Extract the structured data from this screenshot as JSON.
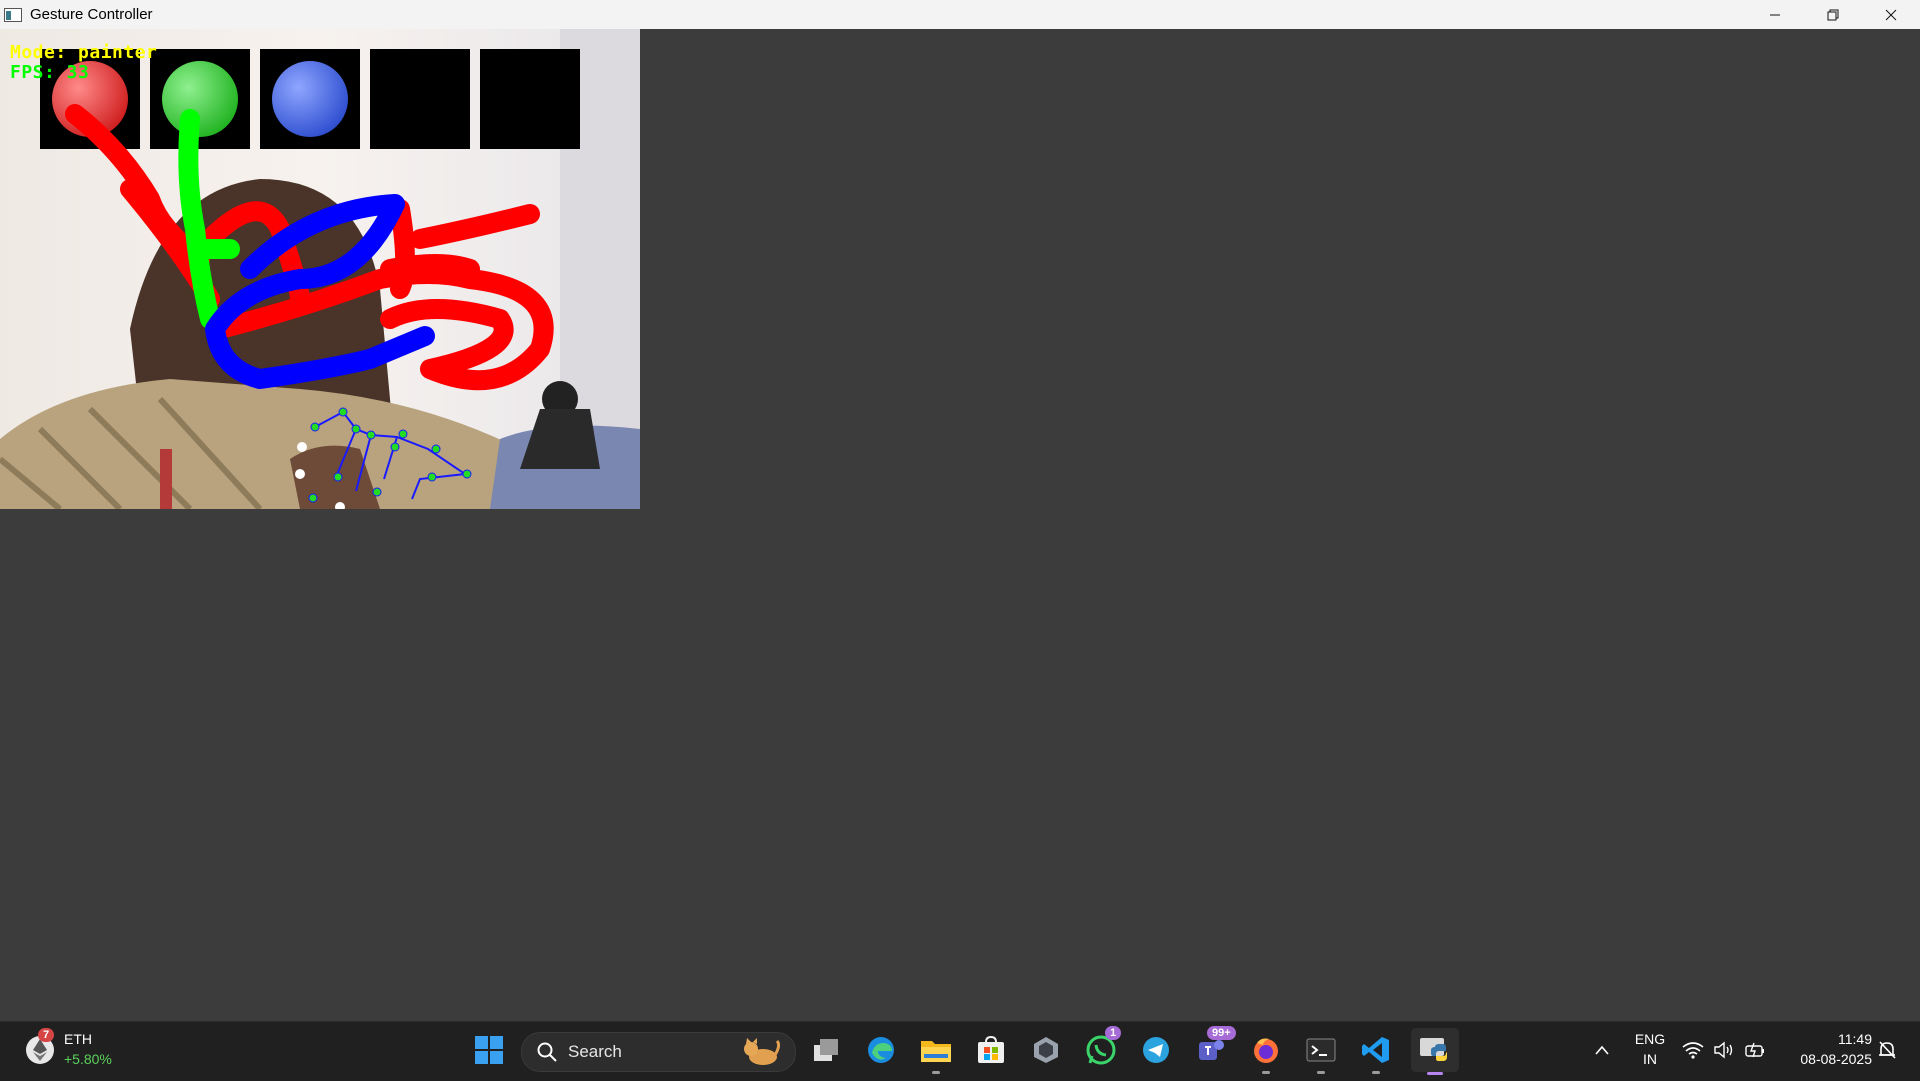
{
  "window": {
    "title": "Gesture Controller",
    "buttons": [
      "minimize",
      "restore",
      "close"
    ]
  },
  "camera_overlay": {
    "mode_text": "Mode: painter",
    "fps_text": "FPS: 33",
    "palette": [
      {
        "name": "red",
        "color": "#e53935"
      },
      {
        "name": "green",
        "color": "#33d133"
      },
      {
        "name": "blue",
        "color": "#3a5bd9"
      },
      {
        "name": "empty-1",
        "color": "#000000"
      },
      {
        "name": "empty-2",
        "color": "#000000"
      }
    ],
    "stroke_colors": {
      "red": "#ff0000",
      "green": "#00ff00",
      "blue": "#0000ff"
    }
  },
  "taskbar": {
    "widget": {
      "ticker": "ETH",
      "change": "+5.80%",
      "badge": "7",
      "change_color": "#5bd15b"
    },
    "search_placeholder": "Search",
    "apps": [
      {
        "name": "start",
        "icon": "windows-start-icon"
      },
      {
        "name": "search"
      },
      {
        "name": "task-view",
        "icon": "task-view-icon"
      },
      {
        "name": "edge",
        "icon": "edge-icon"
      },
      {
        "name": "file-explorer",
        "icon": "folder-icon"
      },
      {
        "name": "store",
        "icon": "store-icon"
      },
      {
        "name": "unity",
        "icon": "cube-icon"
      },
      {
        "name": "whatsapp",
        "icon": "whatsapp-icon",
        "badge": "1"
      },
      {
        "name": "telegram",
        "icon": "telegram-icon"
      },
      {
        "name": "teams",
        "icon": "teams-icon",
        "badge": "99+"
      },
      {
        "name": "firefox",
        "icon": "firefox-icon"
      },
      {
        "name": "terminal",
        "icon": "terminal-icon"
      },
      {
        "name": "vscode",
        "icon": "vscode-icon"
      },
      {
        "name": "python",
        "icon": "python-icon"
      }
    ],
    "tray": {
      "language": "ENG",
      "region": "IN",
      "time": "11:49",
      "date": "08-08-2025"
    }
  }
}
